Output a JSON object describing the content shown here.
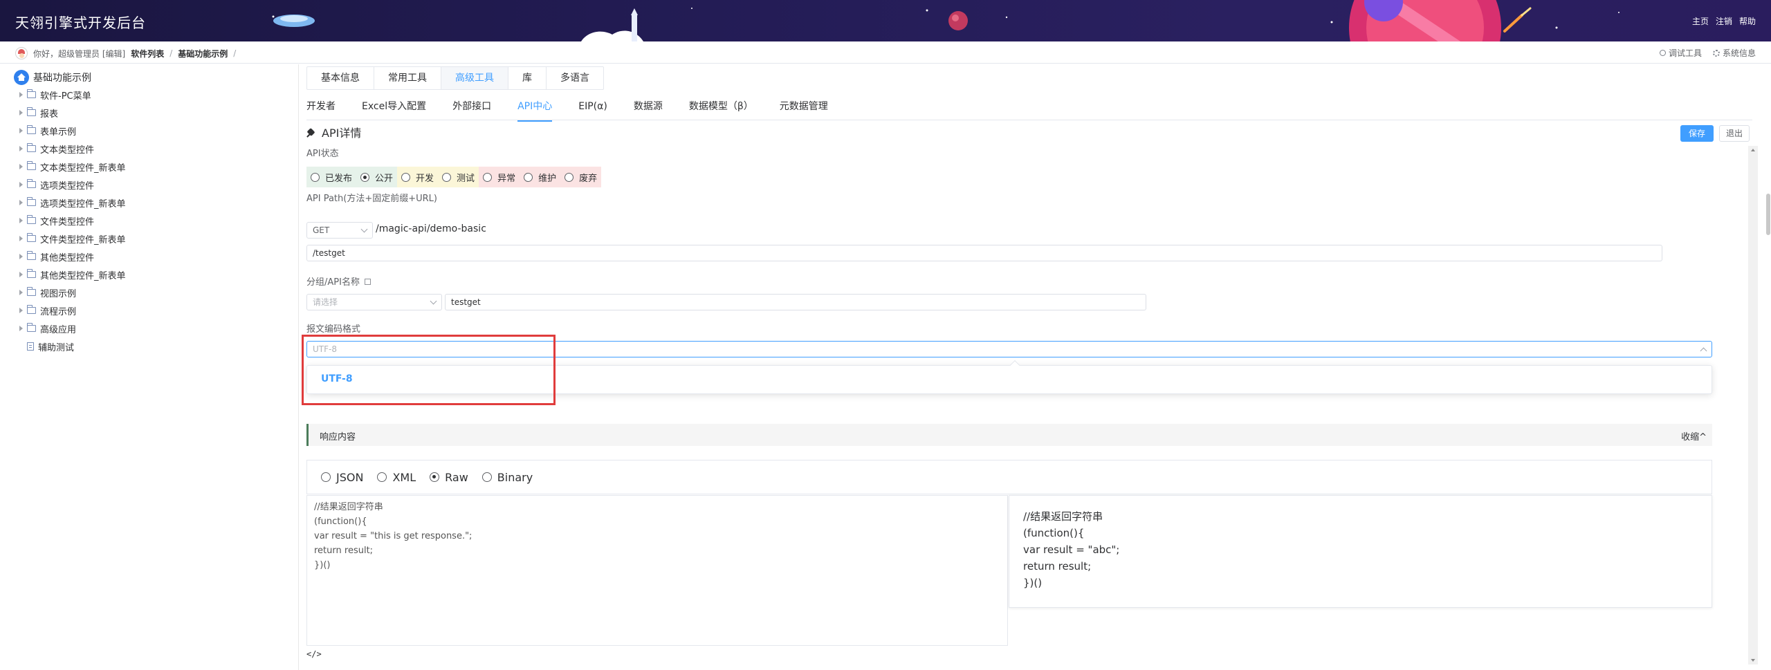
{
  "header": {
    "title": "天翎引擎式开发后台",
    "links": [
      "主页",
      "注销",
      "帮助"
    ]
  },
  "topbar": {
    "greeting": "你好，超级管理员 [编辑]",
    "breadcrumb": [
      "软件列表",
      "基础功能示例"
    ],
    "separator": "/",
    "right": [
      "调试工具",
      "系统信息"
    ]
  },
  "sidebar": {
    "root": "基础功能示例",
    "items": [
      {
        "label": "软件-PC菜单",
        "type": "folder"
      },
      {
        "label": "报表",
        "type": "folder"
      },
      {
        "label": "表单示例",
        "type": "folder"
      },
      {
        "label": "文本类型控件",
        "type": "folder"
      },
      {
        "label": "文本类型控件_新表单",
        "type": "folder"
      },
      {
        "label": "选项类型控件",
        "type": "folder"
      },
      {
        "label": "选项类型控件_新表单",
        "type": "folder"
      },
      {
        "label": "文件类型控件",
        "type": "folder"
      },
      {
        "label": "文件类型控件_新表单",
        "type": "folder"
      },
      {
        "label": "其他类型控件",
        "type": "folder"
      },
      {
        "label": "其他类型控件_新表单",
        "type": "folder"
      },
      {
        "label": "视图示例",
        "type": "folder"
      },
      {
        "label": "流程示例",
        "type": "folder"
      },
      {
        "label": "高级应用",
        "type": "folder"
      },
      {
        "label": "辅助测试",
        "type": "file"
      }
    ]
  },
  "main": {
    "top_tabs": [
      "基本信息",
      "常用工具",
      "高级工具",
      "库",
      "多语言"
    ],
    "top_tab_active": "高级工具",
    "sub_tabs": [
      "开发者",
      "Excel导入配置",
      "外部接口",
      "API中心",
      "EIP(α)",
      "数据源",
      "数据模型（β）",
      "元数据管理"
    ],
    "sub_tab_active": "API中心",
    "section_title": "API详情",
    "save_label": "保存",
    "exit_label": "退出",
    "api_status": {
      "label": "API状态",
      "groups": [
        {
          "bg": "#e6f2ea",
          "options": [
            {
              "label": "已发布",
              "checked": false
            },
            {
              "label": "公开",
              "checked": true
            }
          ]
        },
        {
          "bg": "#fbf6d8",
          "options": [
            {
              "label": "开发",
              "checked": false
            },
            {
              "label": "测试",
              "checked": false
            }
          ]
        },
        {
          "bg": "#fbe3e3",
          "options": [
            {
              "label": "异常",
              "checked": false
            },
            {
              "label": "维护",
              "checked": false
            },
            {
              "label": "废弃",
              "checked": false
            }
          ]
        }
      ]
    },
    "api_path": {
      "label": "API Path(方法+固定前缀+URL)",
      "method": "GET",
      "prefix": "/magic-api/demo-basic",
      "url": "/testget"
    },
    "group_name": {
      "label": "分组/API名称",
      "group_placeholder": "请选择",
      "name": "testget"
    },
    "encoding": {
      "label": "报文编码格式",
      "placeholder": "UTF-8",
      "options": [
        "UTF-8"
      ]
    },
    "response": {
      "title": "响应内容",
      "collapse": "收缩^",
      "formats": [
        {
          "label": "JSON",
          "checked": false
        },
        {
          "label": "XML",
          "checked": false
        },
        {
          "label": "Raw",
          "checked": true
        },
        {
          "label": "Binary",
          "checked": false
        }
      ],
      "code_left": "//结果返回字符串\n(function(){\nvar result = \"this is get response.\";\nreturn result;\n})()",
      "code_right": "//结果返回字符串\n(function(){\nvar result = \"abc\";\nreturn result;\n})()",
      "code_toggle": "</>"
    }
  }
}
